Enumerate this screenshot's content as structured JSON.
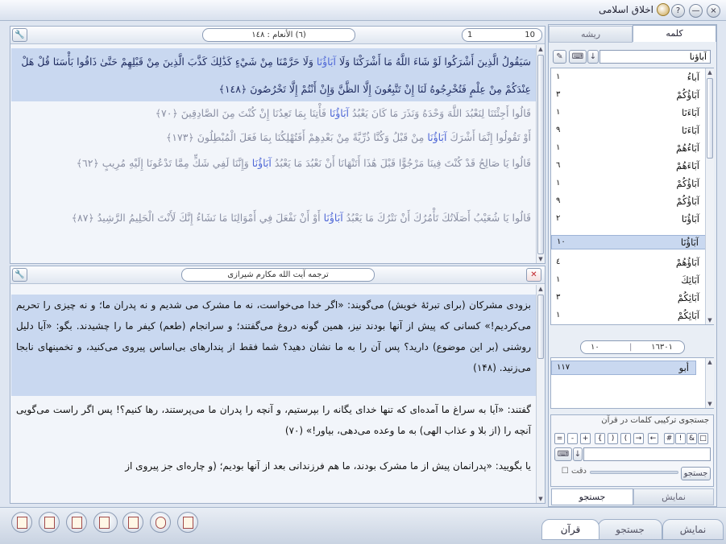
{
  "window": {
    "title": "اخلاق اسلامی",
    "controls": [
      "?",
      "—",
      "×"
    ]
  },
  "quran_panel": {
    "page_from": "1",
    "page_to": "10",
    "surah_title": "(٦) الأنعام : ١٤٨",
    "verses": [
      {
        "text": "سَيَقُولُ الَّذِينَ أَشْرَكُوا لَوْ شَاءَ اللَّهُ مَا أَشْرَكْنَا وَلَا",
        "hl": "آبَاؤُنَا",
        "after": "وَلَا حَرَّمْنَا مِنْ شَيْءٍ كَذَٰلِكَ كَذَّبَ الَّذِينَ مِنْ قَبْلِهِمْ حَتَّىٰ ذَاقُوا بَأْسَنَا قُلْ هَلْ عِنْدَكُمْ مِنْ عِلْمٍ فَتُخْرِجُوهُ لَنَا إِنْ تَتَّبِعُونَ إِلَّا الظَّنَّ وَإِنْ أَنْتُمْ إِلَّا تَخْرُصُونَ ﴿١٤٨﴾"
      },
      {
        "text": "قَالُوا أَجِئْتَنَا لِنَعْبُدَ اللَّهَ وَحْدَهُ وَنَذَرَ مَا كَانَ يَعْبُدُ",
        "hl": "آبَاؤُنَا",
        "after": "فَأْتِنَا بِمَا تَعِدُنَا إِنْ كُنْتَ مِنَ الصَّادِقِينَ ﴿٧٠﴾"
      },
      {
        "text": "أَوْ تَقُولُوا إِنَّمَا أَشْرَكَ",
        "hl": "آبَاؤُنَا",
        "after": "مِنْ قَبْلُ وَكُنَّا ذُرِّيَّةً مِنْ بَعْدِهِمْ أَفَتُهْلِكُنَا بِمَا فَعَلَ الْمُبْطِلُونَ ﴿١٧٣﴾"
      },
      {
        "text": "قَالُوا يَا صَالِحُ قَدْ كُنْتَ فِينَا مَرْجُوًّا قَبْلَ هَٰذَا أَتَنْهَانَا أَنْ نَعْبُدَ مَا يَعْبُدُ",
        "hl": "آبَاؤُنَا",
        "after": "وَإِنَّنَا لَفِي شَكٍّ مِمَّا تَدْعُونَا إِلَيْهِ مُرِيبٍ ﴿٦٢﴾"
      },
      {
        "text": "قَالُوا يَا شُعَيْبُ أَصَلَاتُكَ تَأْمُرُكَ أَنْ نَتْرُكَ مَا يَعْبُدُ",
        "hl": "آبَاؤُنَا",
        "after": "أَوْ أَنْ نَفْعَلَ فِي أَمْوَالِنَا مَا نَشَاءُ إِنَّكَ لَأَنْتَ الْحَلِيمُ الرَّشِيدُ ﴿٨٧﴾"
      }
    ]
  },
  "translation_panel": {
    "title": "ترجمه آیت الله مکارم شیرازی",
    "paragraphs": [
      "بزودی مشرکان (برای تبرئهٔ خویش) می‌گویند: «اگر خدا می‌خواست، نه ما مشرک می‌ شدیم و نه پدران ما؛ و نه چیزی را تحریم می‌کردیم!» کسانی که پیش از آنها بودند نیز، همین گونه دروغ می‌گفتند؛ و سرانجام (طعم) کیفر ما را چشیدند. بگو: «آیا دلیل روشنی (بر این موضوع) دارید؟ پس آن را به ما نشان دهید؟ شما فقط از پندارهای بی‌اساس پیروی می‌کنید، و تخمینهای نابجا می‌زنید. (۱۴۸)",
      "گفتند: «آیا به سراغ ما آمده‌ای که تنها خدای یگانه را بپرستیم، و آنچه را پدران ما می‌پرستند، رها کنیم؟! پس اگر راست می‌گویی آنچه را (از بلا و عذاب الهی) به ما وعده می‌دهی، بیاور!» (۷۰)",
      "یا بگویید: «پدرانمان پیش از ما مشرک بودند، ما هم فرزندانی بعد از آنها بودیم؛ (و چاره‌ای جز پیروی از"
    ]
  },
  "sidebar": {
    "tabs": [
      "کلمه",
      "ریشه"
    ],
    "search_value": "آباؤنا",
    "words": [
      {
        "w": "آباءُ",
        "n": "١"
      },
      {
        "w": "آبَاؤُكُمْ",
        "n": "٣"
      },
      {
        "w": "آبَاءَنَا",
        "n": "١"
      },
      {
        "w": "آبَاءَنَا",
        "n": "٩"
      },
      {
        "w": "آبَاءُهُمْ",
        "n": "١"
      },
      {
        "w": "آبَاءَهُمْ",
        "n": "٦"
      },
      {
        "w": "آبَاؤُكُمْ",
        "n": "١"
      },
      {
        "w": "آبَاؤُكُمْ",
        "n": "٩"
      },
      {
        "w": "آبَاؤُنَا",
        "n": "٢"
      },
      {
        "w": "آبَاؤُنَا",
        "n": "١٠"
      },
      {
        "w": "آبَاؤُهُمْ",
        "n": "٤"
      },
      {
        "w": "آبَائِكَ",
        "n": "١"
      },
      {
        "w": "آبَائِكُمْ",
        "n": "٣"
      },
      {
        "w": "آبَائِكُمْ",
        "n": "١"
      }
    ],
    "pager_from": "١٠",
    "pager_to": "١٦٣٠١",
    "roots": [
      {
        "w": "أبو",
        "n": "١١٧"
      }
    ],
    "combined_title": "جستجوی ترکیبی کلمات در قرآن",
    "keys": [
      "□",
      "&",
      "!",
      "#",
      "←",
      "→",
      "(",
      ")",
      "{",
      "+",
      "-",
      "="
    ],
    "search_button": "جستجو",
    "precision_label": "دقت",
    "bottom_tabs": [
      "نمایش",
      "جستجو"
    ]
  },
  "bottom_tabs": [
    "نمایش",
    "جستجو",
    "قرآن"
  ]
}
